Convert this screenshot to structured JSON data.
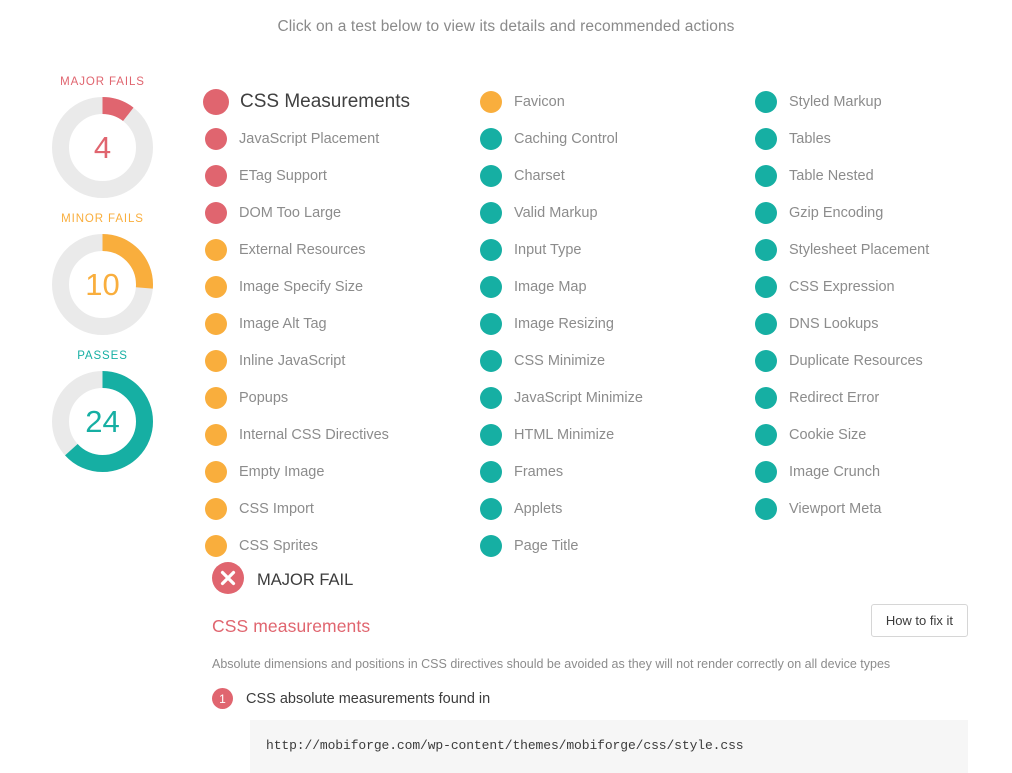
{
  "header": {
    "instruction": "Click on a test below to view its details and recommended actions"
  },
  "colors": {
    "major": "#E0656F",
    "minor": "#F9AE3D",
    "pass": "#16AFA3",
    "track": "#EAEAEA"
  },
  "gauges": [
    {
      "label": "MAJOR FAILS",
      "value": "4",
      "number": 4,
      "percent": 10.5,
      "color": "#E0656F"
    },
    {
      "label": "MINOR FAILS",
      "value": "10",
      "number": 10,
      "percent": 26.3,
      "color": "#F9AE3D"
    },
    {
      "label": "PASSES",
      "value": "24",
      "number": 24,
      "percent": 63.2,
      "color": "#16AFA3"
    }
  ],
  "total_tests": 38,
  "columns": [
    {
      "items": [
        {
          "label": "CSS Measurements",
          "status": "major",
          "selected": true
        },
        {
          "label": "JavaScript Placement",
          "status": "major",
          "selected": false
        },
        {
          "label": "ETag Support",
          "status": "major",
          "selected": false
        },
        {
          "label": "DOM Too Large",
          "status": "major",
          "selected": false
        },
        {
          "label": "External Resources",
          "status": "minor",
          "selected": false
        },
        {
          "label": "Image Specify Size",
          "status": "minor",
          "selected": false
        },
        {
          "label": "Image Alt Tag",
          "status": "minor",
          "selected": false
        },
        {
          "label": "Inline JavaScript",
          "status": "minor",
          "selected": false
        },
        {
          "label": "Popups",
          "status": "minor",
          "selected": false
        },
        {
          "label": "Internal CSS Directives",
          "status": "minor",
          "selected": false
        },
        {
          "label": "Empty Image",
          "status": "minor",
          "selected": false
        },
        {
          "label": "CSS Import",
          "status": "minor",
          "selected": false
        },
        {
          "label": "CSS Sprites",
          "status": "minor",
          "selected": false
        }
      ]
    },
    {
      "items": [
        {
          "label": "Favicon",
          "status": "minor",
          "selected": false
        },
        {
          "label": "Caching Control",
          "status": "pass",
          "selected": false
        },
        {
          "label": "Charset",
          "status": "pass",
          "selected": false
        },
        {
          "label": "Valid Markup",
          "status": "pass",
          "selected": false
        },
        {
          "label": "Input Type",
          "status": "pass",
          "selected": false
        },
        {
          "label": "Image Map",
          "status": "pass",
          "selected": false
        },
        {
          "label": "Image Resizing",
          "status": "pass",
          "selected": false
        },
        {
          "label": "CSS Minimize",
          "status": "pass",
          "selected": false
        },
        {
          "label": "JavaScript Minimize",
          "status": "pass",
          "selected": false
        },
        {
          "label": "HTML Minimize",
          "status": "pass",
          "selected": false
        },
        {
          "label": "Frames",
          "status": "pass",
          "selected": false
        },
        {
          "label": "Applets",
          "status": "pass",
          "selected": false
        },
        {
          "label": "Page Title",
          "status": "pass",
          "selected": false
        }
      ]
    },
    {
      "items": [
        {
          "label": "Styled Markup",
          "status": "pass",
          "selected": false
        },
        {
          "label": "Tables",
          "status": "pass",
          "selected": false
        },
        {
          "label": "Table Nested",
          "status": "pass",
          "selected": false
        },
        {
          "label": "Gzip Encoding",
          "status": "pass",
          "selected": false
        },
        {
          "label": "Stylesheet Placement",
          "status": "pass",
          "selected": false
        },
        {
          "label": "CSS Expression",
          "status": "pass",
          "selected": false
        },
        {
          "label": "DNS Lookups",
          "status": "pass",
          "selected": false
        },
        {
          "label": "Duplicate Resources",
          "status": "pass",
          "selected": false
        },
        {
          "label": "Redirect Error",
          "status": "pass",
          "selected": false
        },
        {
          "label": "Cookie Size",
          "status": "pass",
          "selected": false
        },
        {
          "label": "Image Crunch",
          "status": "pass",
          "selected": false
        },
        {
          "label": "Viewport Meta",
          "status": "pass",
          "selected": false
        }
      ]
    }
  ],
  "detail": {
    "status_label": "MAJOR FAIL",
    "title": "CSS measurements",
    "fix_button": "How to fix it",
    "description": "Absolute dimensions and positions in CSS directives should be avoided as they will not render correctly on all device types",
    "findings": [
      {
        "index": "1",
        "text": "CSS absolute measurements found in",
        "code": "http://mobiforge.com/wp-content/themes/mobiforge/css/style.css"
      }
    ]
  }
}
